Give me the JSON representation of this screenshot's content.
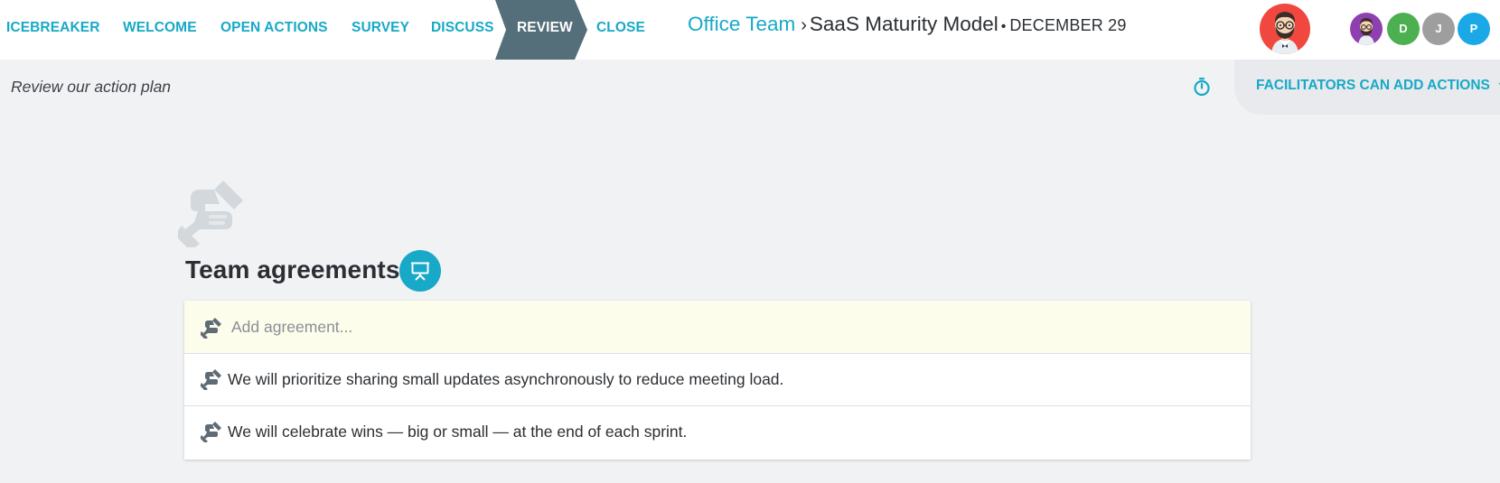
{
  "nav": {
    "steps": [
      {
        "label": "ICEBREAKER",
        "active": false
      },
      {
        "label": "WELCOME",
        "active": false
      },
      {
        "label": "OPEN ACTIONS",
        "active": false
      },
      {
        "label": "SURVEY",
        "active": false
      },
      {
        "label": "DISCUSS",
        "active": false
      },
      {
        "label": "REVIEW",
        "active": true
      },
      {
        "label": "CLOSE",
        "active": false
      }
    ]
  },
  "header": {
    "team": "Office Team",
    "separator": "›",
    "retro_name": "SaaS Maturity Model",
    "dot": "•",
    "date": "DECEMBER 29"
  },
  "participants": [
    {
      "initial": "",
      "color": "#8e3fb0",
      "icon": "bearded-man-avatar-icon"
    },
    {
      "initial": "D",
      "color": "#4caf50"
    },
    {
      "initial": "J",
      "color": "#9e9e9e"
    },
    {
      "initial": "P",
      "color": "#1aa8e6"
    }
  ],
  "facilitator_avatar": {
    "icon": "bearded-man-avatar-icon",
    "color": "#f0483e"
  },
  "subheader": {
    "subtitle": "Review our action plan",
    "actions_dropdown": "FACILITATORS CAN ADD ACTIONS"
  },
  "agreements": {
    "title": "Team agreements",
    "add_placeholder": "Add agreement...",
    "items": [
      "We will prioritize sharing small updates asynchronously to reduce meeting load.",
      "We will celebrate wins — big or small — at the end of each sprint."
    ]
  },
  "colors": {
    "accent": "#17a9c7",
    "active_step": "#546e7a",
    "icon_gray": "#5f6b75",
    "background": "#f1f2f4"
  }
}
